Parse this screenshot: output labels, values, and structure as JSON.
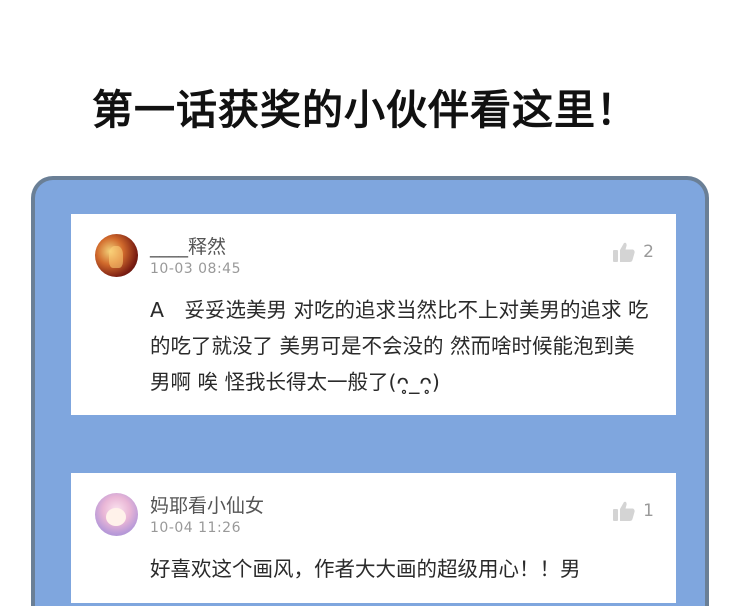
{
  "headline": "第一话获奖的小伙伴看这里！",
  "comments": [
    {
      "username": "____释然",
      "timestamp": "10-03 08:45",
      "likes": "2",
      "text": "A　妥妥选美男 对吃的追求当然比不上对美男的追求 吃的吃了就没了 美男可是不会没的 然而啥时候能泡到美男啊 唉 怪我长得太一般了(ᴖ̥_ᴖ̥)",
      "avatar_icon": "user-avatar-icon"
    },
    {
      "username": "妈耶看小仙女",
      "timestamp": "10-04 11:26",
      "likes": "1",
      "text": "好喜欢这个画风，作者大大画的超级用心！！男",
      "avatar_icon": "user-avatar-icon"
    }
  ],
  "colors": {
    "panel_blue": "#7fa6de",
    "panel_border": "#6a7f96",
    "card_bg": "#ffffff"
  }
}
